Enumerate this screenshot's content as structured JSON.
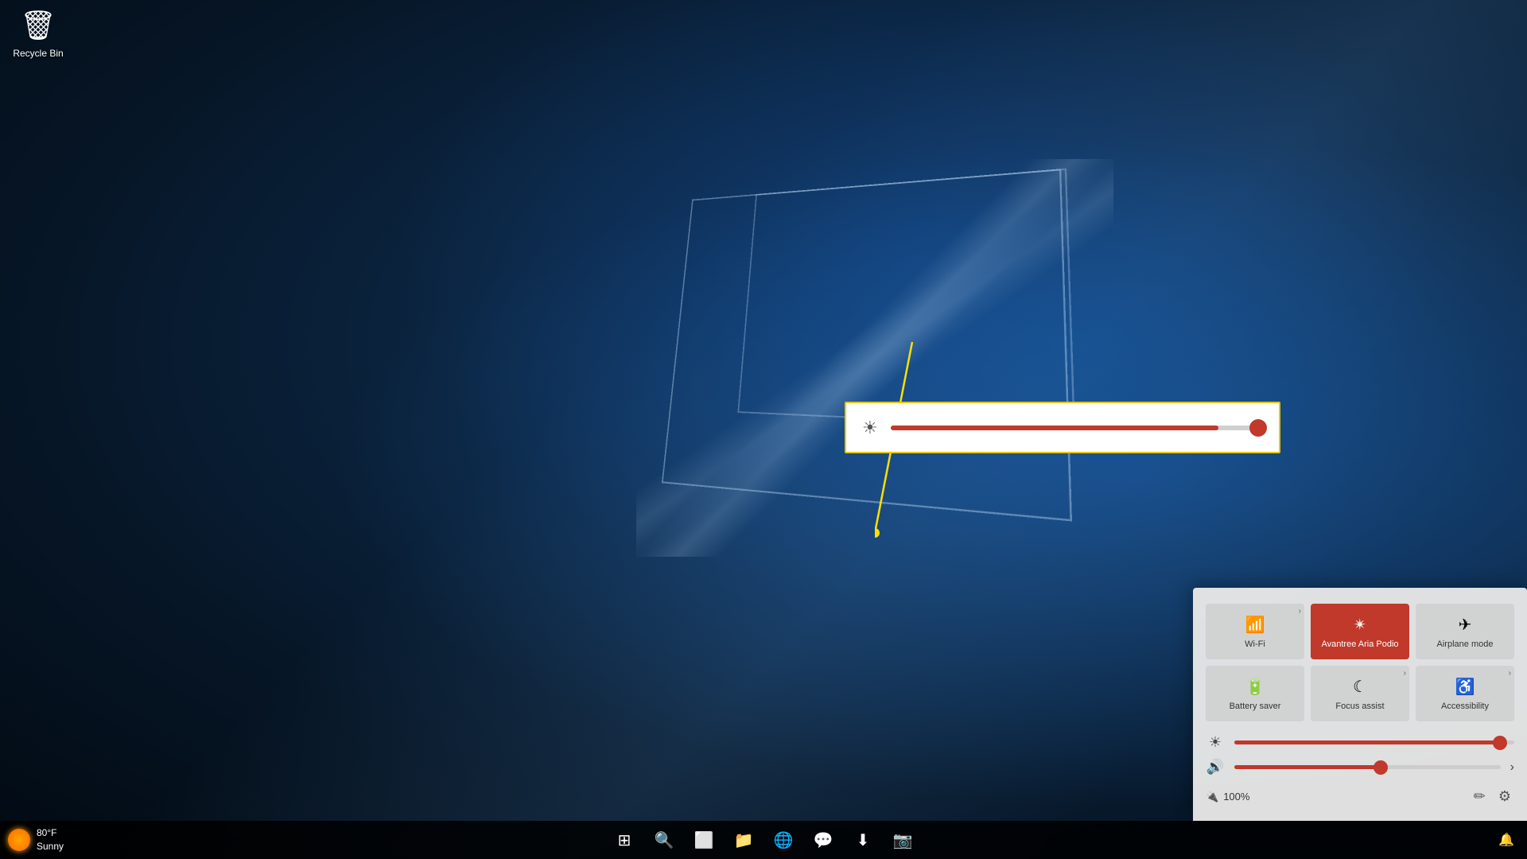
{
  "desktop": {
    "background": "Windows 10 blue desktop"
  },
  "recycle_bin": {
    "label": "Recycle Bin",
    "icon": "🗑"
  },
  "brightness_popup": {
    "value": 88,
    "icon": "☀"
  },
  "action_center": {
    "quick_actions": [
      {
        "id": "wifi",
        "label": "Wi-Fi",
        "icon": "📶",
        "active": false,
        "expand": true
      },
      {
        "id": "bluetooth",
        "label": "Avantree Aria\nPodio",
        "icon": "🔵",
        "active": true,
        "expand": false
      },
      {
        "id": "airplane",
        "label": "Airplane mode",
        "icon": "✈",
        "active": false,
        "expand": false
      },
      {
        "id": "battery_saver",
        "label": "Battery saver",
        "icon": "🔋",
        "active": false,
        "expand": false
      },
      {
        "id": "focus_assist",
        "label": "Focus assist",
        "icon": "🌙",
        "active": false,
        "expand": true
      },
      {
        "id": "accessibility",
        "label": "Accessibility",
        "icon": "♿",
        "active": false,
        "expand": true
      }
    ],
    "brightness_slider": {
      "value": 95,
      "icon": "☀"
    },
    "volume_slider": {
      "value": 55,
      "icon": "🔊",
      "end_icon": "›"
    },
    "battery": {
      "icon": "🔌",
      "percent": "100%",
      "label": "100%"
    }
  },
  "taskbar": {
    "weather": {
      "temp": "80°F",
      "condition": "Sunny"
    },
    "buttons": [
      {
        "id": "start",
        "icon": "⊞"
      },
      {
        "id": "search",
        "icon": "🔍"
      },
      {
        "id": "task_view",
        "icon": "⬜"
      },
      {
        "id": "file_manager",
        "icon": "📁"
      },
      {
        "id": "edge",
        "icon": "🌐"
      },
      {
        "id": "discord",
        "icon": "💬"
      },
      {
        "id": "qbittorrent",
        "icon": "⬇"
      },
      {
        "id": "app",
        "icon": "📷"
      }
    ]
  }
}
